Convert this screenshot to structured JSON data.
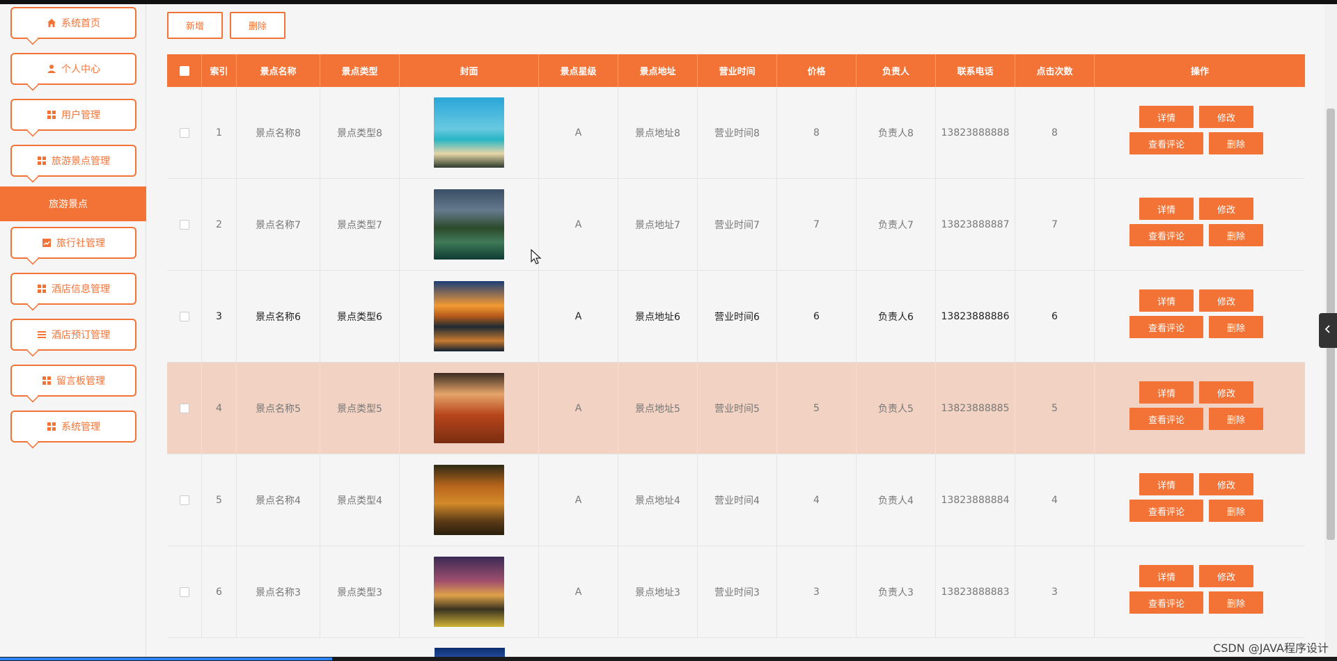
{
  "sidebar": {
    "items": [
      {
        "label": "系统首页",
        "icon": "home-icon"
      },
      {
        "label": "个人中心",
        "icon": "user-icon"
      },
      {
        "label": "用户管理",
        "icon": "grid-icon"
      },
      {
        "label": "旅游景点管理",
        "icon": "grid-icon"
      },
      {
        "label": "旅行社管理",
        "icon": "chart-icon"
      },
      {
        "label": "酒店信息管理",
        "icon": "grid-icon"
      },
      {
        "label": "酒店预订管理",
        "icon": "list-icon"
      },
      {
        "label": "留言板管理",
        "icon": "grid-icon"
      },
      {
        "label": "系统管理",
        "icon": "grid-icon"
      }
    ],
    "submenu_active": "旅游景点"
  },
  "toolbar": {
    "add_label": "新增",
    "delete_label": "删除"
  },
  "table": {
    "columns": [
      "索引",
      "景点名称",
      "景点类型",
      "封面",
      "景点星级",
      "景点地址",
      "营业时间",
      "价格",
      "负责人",
      "联系电话",
      "点击次数",
      "操作"
    ],
    "actions": {
      "detail": "详情",
      "edit": "修改",
      "comments": "查看评论",
      "delete": "删除"
    },
    "rows": [
      {
        "index": "1",
        "name": "景点名称8",
        "type": "景点类型8",
        "level": "A",
        "address": "景点地址8",
        "hours": "营业时间8",
        "price": "8",
        "owner": "负责人8",
        "phone": "13823888888",
        "clicks": "8",
        "cover": "beach"
      },
      {
        "index": "2",
        "name": "景点名称7",
        "type": "景点类型7",
        "level": "A",
        "address": "景点地址7",
        "hours": "营业时间7",
        "price": "7",
        "owner": "负责人7",
        "phone": "13823888887",
        "clicks": "7",
        "cover": "river-trees"
      },
      {
        "index": "3",
        "name": "景点名称6",
        "type": "景点类型6",
        "level": "A",
        "address": "景点地址6",
        "hours": "营业时间6",
        "price": "6",
        "owner": "负责人6",
        "phone": "13823888886",
        "clicks": "6",
        "cover": "sunset-lake"
      },
      {
        "index": "4",
        "name": "景点名称5",
        "type": "景点类型5",
        "level": "A",
        "address": "景点地址5",
        "hours": "营业时间5",
        "price": "5",
        "owner": "负责人5",
        "phone": "13823888885",
        "clicks": "5",
        "cover": "orange-field"
      },
      {
        "index": "5",
        "name": "景点名称4",
        "type": "景点类型4",
        "level": "A",
        "address": "景点地址4",
        "hours": "营业时间4",
        "price": "4",
        "owner": "负责人4",
        "phone": "13823888884",
        "clicks": "4",
        "cover": "autumn-path"
      },
      {
        "index": "6",
        "name": "景点名称3",
        "type": "景点类型3",
        "level": "A",
        "address": "景点地址3",
        "hours": "营业时间3",
        "price": "3",
        "owner": "负责人3",
        "phone": "13823888883",
        "clicks": "3",
        "cover": "flower-mountain"
      }
    ]
  },
  "watermark": "CSDN @JAVA程序设计",
  "colors": {
    "accent": "#f37336",
    "row_highlight": "#f2d2c2"
  }
}
